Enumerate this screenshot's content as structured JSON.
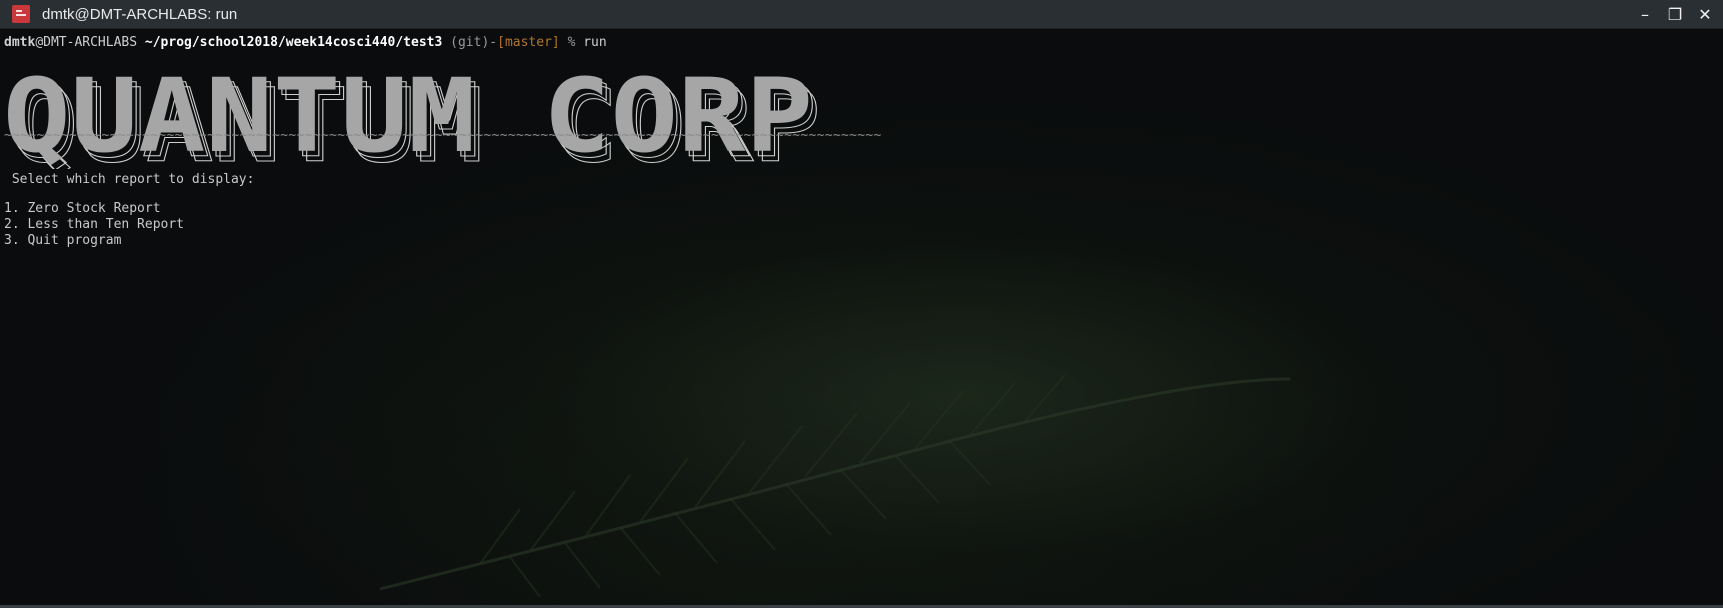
{
  "window": {
    "title": "dmtk@DMT-ARCHLABS: run",
    "icons": {
      "app": "terminal-app-icon",
      "minimize": "minimize-icon",
      "maximize": "maximize-icon",
      "close": "close-icon"
    },
    "controls": {
      "minimize": "–",
      "maximize": "❐",
      "close": "✕"
    }
  },
  "prompt": {
    "user": "dmtk",
    "at": "@",
    "host": "DMT-ARCHLABS",
    "path": "~/prog/school2018/week14cosci440/test3",
    "git_open": "(",
    "git": "git",
    "git_close": ")",
    "dash": "-",
    "branch_open": "[",
    "branch": "master",
    "branch_close": "]",
    "symbol": "%",
    "command": "run"
  },
  "banner": {
    "text": "QUANTUM CORP",
    "underline": "~~~~~~~~~~~~~~~~~~~~~~~~~~~~~~~~~~~~~~~~~~~~~~~~~~~~~~~~~~~~~~~~~~~~~~~~~~~~~~~~~~~~~~~~~~~~~~~~~~~~~~~~~~~~"
  },
  "menu": {
    "prompt": " Select which report to display:",
    "options": [
      "1. Zero Stock Report",
      "2. Less than Ten Report",
      "3. Quit program"
    ]
  },
  "colors": {
    "background": "#0a0c0d",
    "titlebar": "#2a2f33",
    "branch": "#b0752f",
    "banner_fill": "#a6a6a6"
  }
}
